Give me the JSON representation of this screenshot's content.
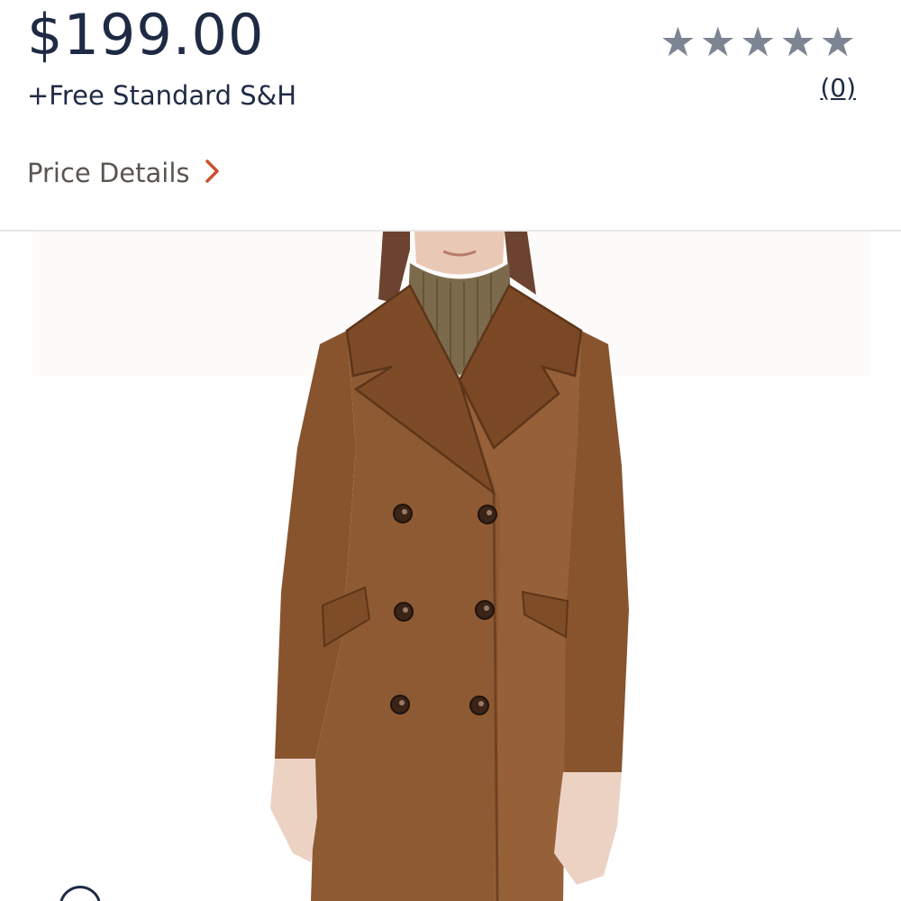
{
  "product": {
    "price": "$199.00",
    "shipping": "+Free Standard S&H",
    "rating": {
      "stars": 5,
      "filled": 0,
      "review_count_label": "(0)"
    },
    "price_details_label": "Price Details",
    "image": {
      "alt": "Brown double-breasted long wool coat"
    }
  },
  "colors": {
    "price_text": "#1f2a44",
    "star_empty": "#7d8593",
    "chevron": "#c8512a",
    "coat": "#8a5530"
  },
  "icons": {
    "star": "star-icon",
    "chevron": "chevron-right-icon"
  }
}
